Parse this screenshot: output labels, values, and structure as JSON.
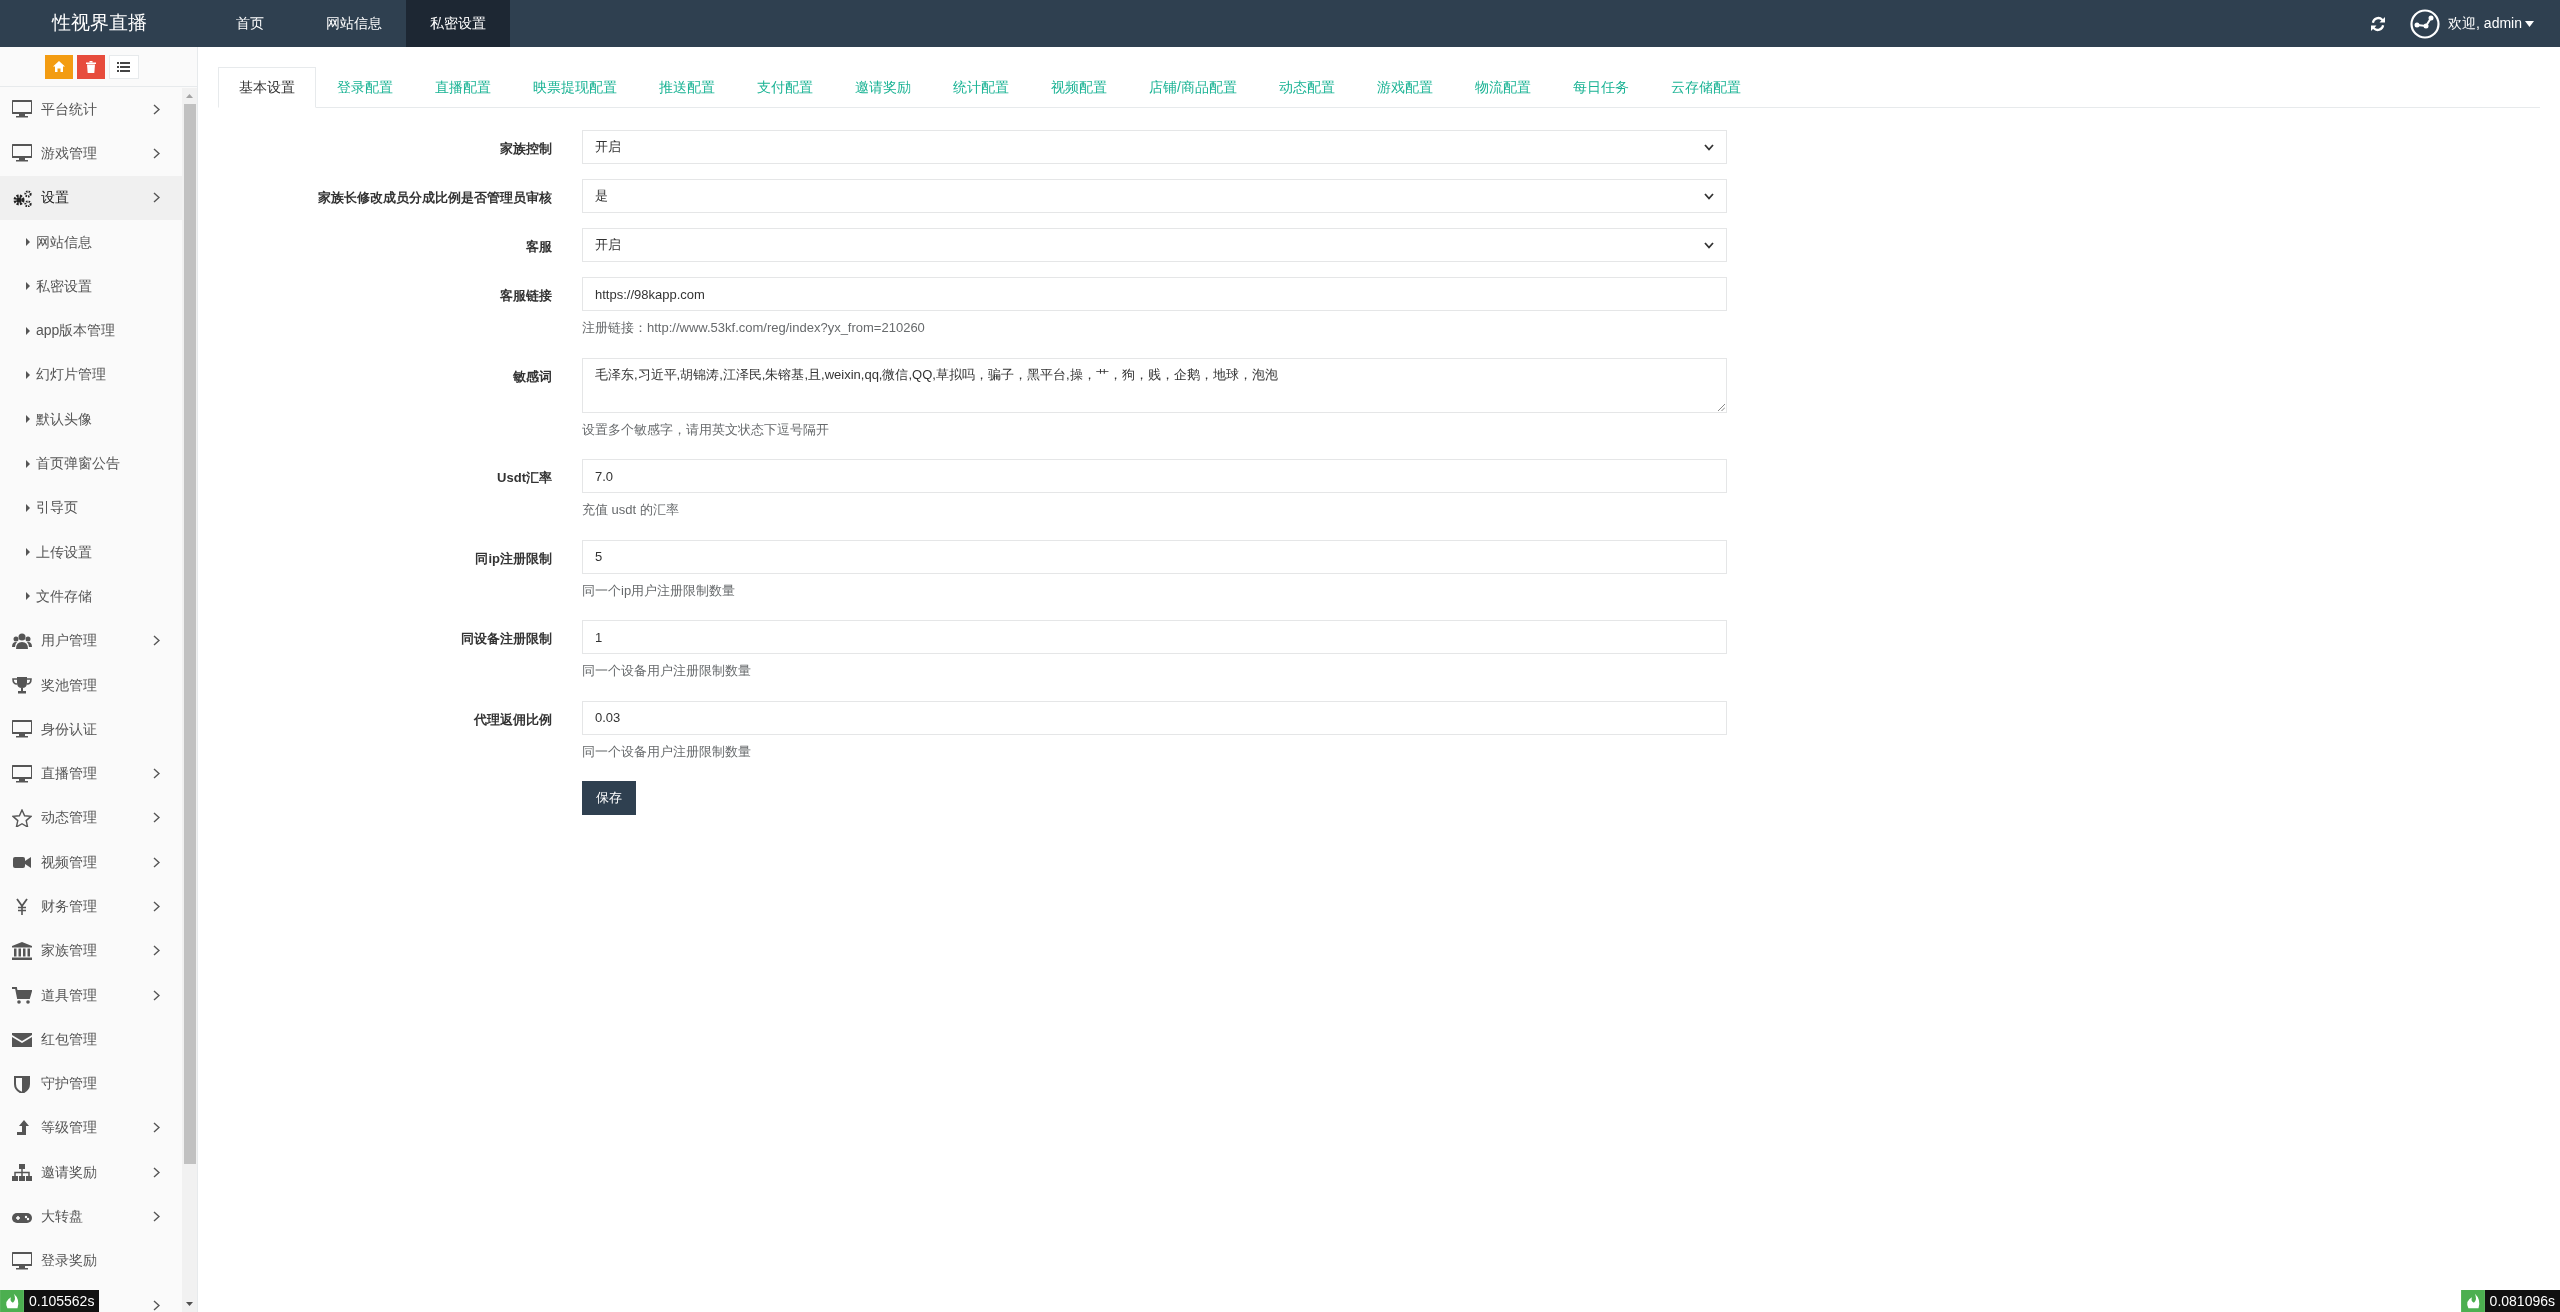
{
  "header": {
    "logo": "性视界直播",
    "nav": [
      {
        "label": "首页",
        "selected": false
      },
      {
        "label": "网站信息",
        "selected": false
      },
      {
        "label": "私密设置",
        "selected": true
      }
    ],
    "user": "欢迎, admin"
  },
  "sidebar": {
    "items": [
      {
        "label": "平台统计",
        "expandable": true,
        "selected": false
      },
      {
        "label": "游戏管理",
        "expandable": true,
        "selected": false
      },
      {
        "label": "设置",
        "expandable": true,
        "selected": true,
        "children": [
          {
            "label": "网站信息"
          },
          {
            "label": "私密设置"
          },
          {
            "label": "app版本管理"
          },
          {
            "label": "幻灯片管理"
          },
          {
            "label": "默认头像"
          },
          {
            "label": "首页弹窗公告"
          },
          {
            "label": "引导页"
          },
          {
            "label": "上传设置"
          },
          {
            "label": "文件存储"
          }
        ]
      },
      {
        "label": "用户管理",
        "expandable": true,
        "selected": false
      },
      {
        "label": "奖池管理",
        "expandable": false,
        "selected": false
      },
      {
        "label": "身份认证",
        "expandable": false,
        "selected": false
      },
      {
        "label": "直播管理",
        "expandable": true,
        "selected": false
      },
      {
        "label": "动态管理",
        "expandable": true,
        "selected": false
      },
      {
        "label": "视频管理",
        "expandable": true,
        "selected": false
      },
      {
        "label": "财务管理",
        "expandable": true,
        "selected": false
      },
      {
        "label": "家族管理",
        "expandable": true,
        "selected": false
      },
      {
        "label": "道具管理",
        "expandable": true,
        "selected": false
      },
      {
        "label": "红包管理",
        "expandable": false,
        "selected": false
      },
      {
        "label": "守护管理",
        "expandable": false,
        "selected": false
      },
      {
        "label": "等级管理",
        "expandable": true,
        "selected": false
      },
      {
        "label": "邀请奖励",
        "expandable": true,
        "selected": false
      },
      {
        "label": "大转盘",
        "expandable": true,
        "selected": false
      },
      {
        "label": "登录奖励",
        "expandable": false,
        "selected": false
      }
    ]
  },
  "tabs": [
    {
      "label": "基本设置",
      "selected": true
    },
    {
      "label": "登录配置",
      "selected": false
    },
    {
      "label": "直播配置",
      "selected": false
    },
    {
      "label": "映票提现配置",
      "selected": false
    },
    {
      "label": "推送配置",
      "selected": false
    },
    {
      "label": "支付配置",
      "selected": false
    },
    {
      "label": "邀请奖励",
      "selected": false
    },
    {
      "label": "统计配置",
      "selected": false
    },
    {
      "label": "视频配置",
      "selected": false
    },
    {
      "label": "店铺/商品配置",
      "selected": false
    },
    {
      "label": "动态配置",
      "selected": false
    },
    {
      "label": "游戏配置",
      "selected": false
    },
    {
      "label": "物流配置",
      "selected": false
    },
    {
      "label": "每日任务",
      "selected": false
    },
    {
      "label": "云存储配置",
      "selected": false
    }
  ],
  "form": {
    "fields": [
      {
        "kind": "select",
        "label": "家族控制",
        "value": "开启"
      },
      {
        "kind": "select",
        "label": "家族长修改成员分成比例是否管理员审核",
        "value": "是"
      },
      {
        "kind": "select",
        "label": "客服",
        "value": "开启"
      },
      {
        "kind": "text",
        "label": "客服链接",
        "value": "https://98kapp.com",
        "help": "注册链接：http://www.53kf.com/reg/index?yx_from=210260"
      },
      {
        "kind": "textarea",
        "label": "敏感词",
        "value": "毛泽东,习近平,胡锦涛,江泽民,朱镕基,且,weixin,qq,微信,QQ,草拟吗，骗子，黑平台,操，艹，狗，贱，企鹅，地球，泡泡",
        "help": "设置多个敏感字，请用英文状态下逗号隔开"
      },
      {
        "kind": "text",
        "label": "Usdt汇率",
        "value": "7.0",
        "help": "充值 usdt 的汇率"
      },
      {
        "kind": "text",
        "label": "同ip注册限制",
        "value": "5",
        "help": "同一个ip用户注册限制数量"
      },
      {
        "kind": "text",
        "label": "同设备注册限制",
        "value": "1",
        "help": "同一个设备用户注册限制数量"
      },
      {
        "kind": "text",
        "label": "代理返佣比例",
        "value": "0.03",
        "help": "同一个设备用户注册限制数量"
      }
    ],
    "submit": "保存"
  },
  "timers": [
    "0.105562s",
    "0.081096s"
  ]
}
